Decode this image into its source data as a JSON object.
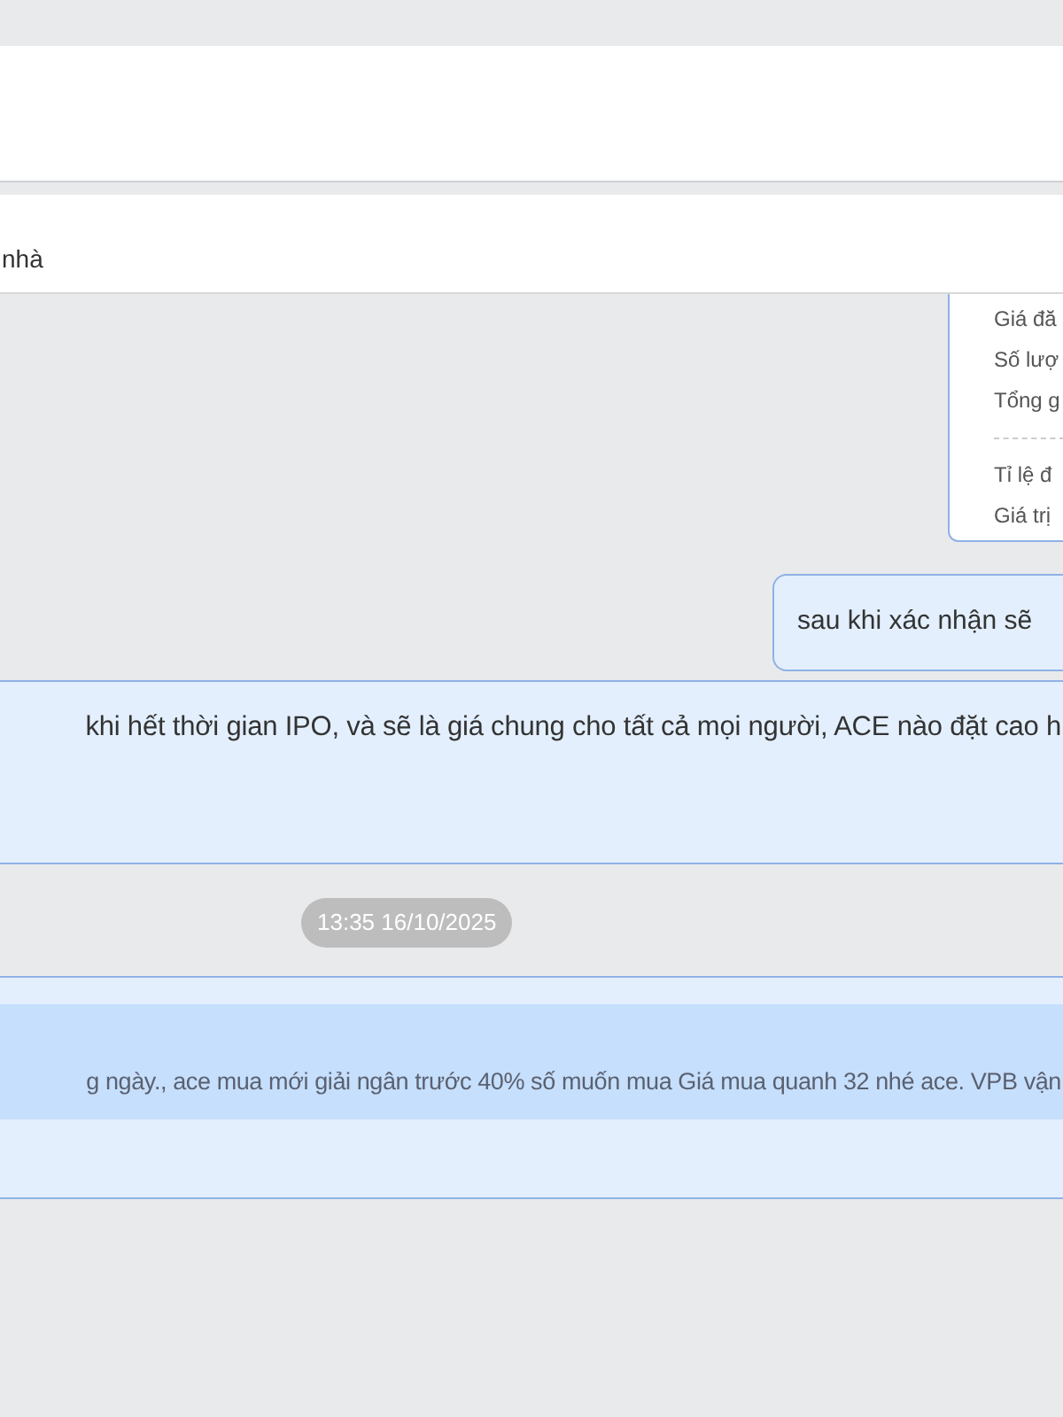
{
  "header_bar": {
    "title": "nhà"
  },
  "order_card": {
    "lines": [
      {
        "kind": "text",
        "label": "Giá đă"
      },
      {
        "kind": "text",
        "label": "Số lượ"
      },
      {
        "kind": "text",
        "label": "Tổng g"
      },
      {
        "kind": "divider"
      },
      {
        "kind": "text",
        "label": "Tỉ lệ đ"
      },
      {
        "kind": "text",
        "label": "Giá trị"
      }
    ]
  },
  "messages": [
    {
      "kind": "outgoing",
      "text": "sau khi xác nhận sẽ"
    },
    {
      "kind": "wide",
      "text": "khi hết thời gian IPO, và sẽ là giá chung cho tất cả mọi người, ACE nào đặt cao h"
    },
    {
      "kind": "timestamp",
      "text": "13:35 16/10/2025"
    },
    {
      "kind": "highlighted",
      "text": "g ngày., ace mua mới giải ngân trước 40% số muốn mua Giá mua quanh 32 nhé ace. VPB vận"
    }
  ]
}
